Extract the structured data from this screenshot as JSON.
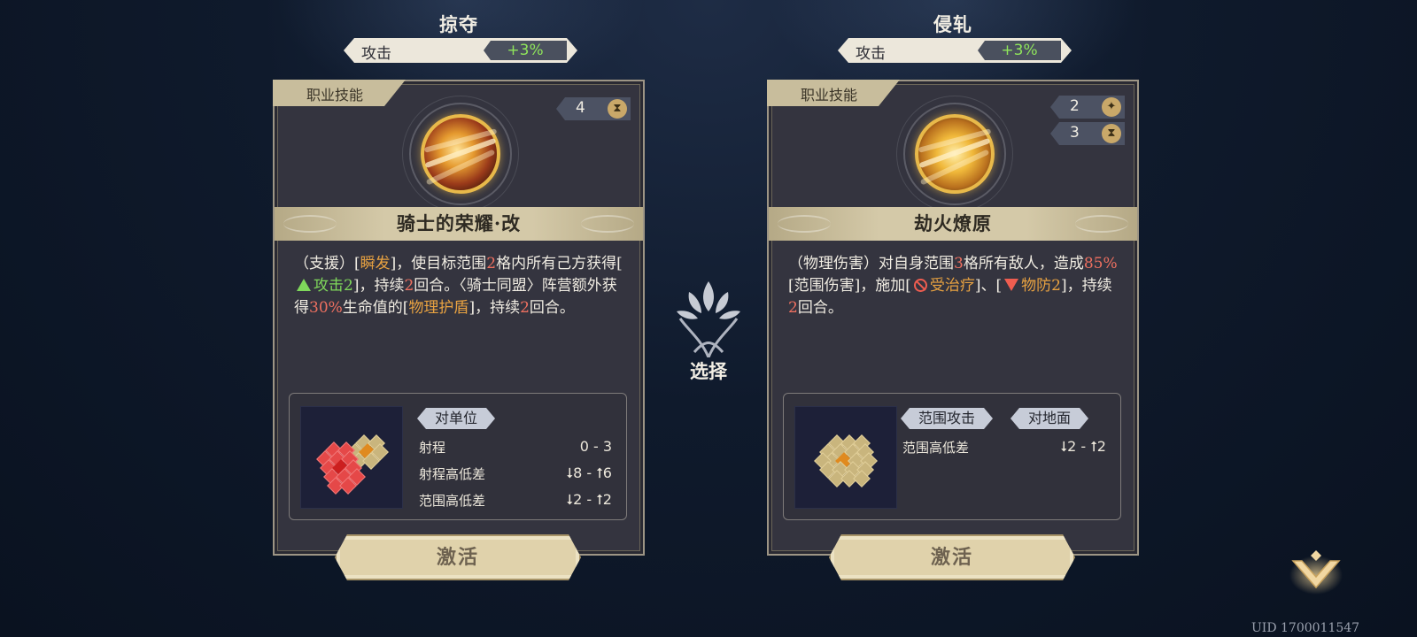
{
  "left_card": {
    "title": "掠夺",
    "stat": {
      "label": "攻击",
      "value": "+3%"
    },
    "tag": "职业技能",
    "counters": [
      {
        "value": "4",
        "icon": "hourglass-icon"
      }
    ],
    "skill_name": "骑士的荣耀·改",
    "desc": {
      "p1": "（支援）[",
      "k1": "瞬发",
      "p2": "]，使目标范围",
      "n1": "2",
      "p3": "格内所有己方获得[",
      "k2": "攻击2",
      "p4": "]，持续",
      "n2": "2",
      "p5": "回合。〈骑士同盟〉阵营额外获得",
      "n3": "30%",
      "p6": "生命值的[",
      "k3": "物理护盾",
      "p7": "]，持续",
      "n4": "2",
      "p8": "回合。"
    },
    "pills": [
      "对单位"
    ],
    "rows": [
      {
        "label": "射程",
        "value": "0 - 3"
      },
      {
        "label": "射程高低差",
        "value": "⭣8 - ⭡6"
      },
      {
        "label": "范围高低差",
        "value": "⭣2 - ⭡2"
      }
    ],
    "button": "激活"
  },
  "right_card": {
    "title": "侵轧",
    "stat": {
      "label": "攻击",
      "value": "+3%"
    },
    "tag": "职业技能",
    "counters": [
      {
        "value": "2",
        "icon": "star-icon"
      },
      {
        "value": "3",
        "icon": "hourglass-icon"
      }
    ],
    "skill_name": "劫火燎原",
    "desc": {
      "p1": "（物理伤害）对自身范围",
      "n1": "3",
      "p2": "格所有敌人，造成",
      "n2": "85%",
      "p3": "[范围伤害]，施加[",
      "k1": "受治疗",
      "p4": "]、[",
      "k2": "物防2",
      "p5": "]，持续",
      "n3": "2",
      "p6": "回合。"
    },
    "pills": [
      "范围攻击",
      "对地面"
    ],
    "rows": [
      {
        "label": "范围高低差",
        "value": "⭣2 - ⭡2"
      }
    ],
    "button": "激活"
  },
  "center": {
    "label": "选择"
  },
  "uid": "UID 1700011547",
  "colors": {
    "accent_green": "#8fe45b",
    "orange": "#e8a241",
    "red": "#ee7060",
    "banner": "#d4c9a8"
  }
}
